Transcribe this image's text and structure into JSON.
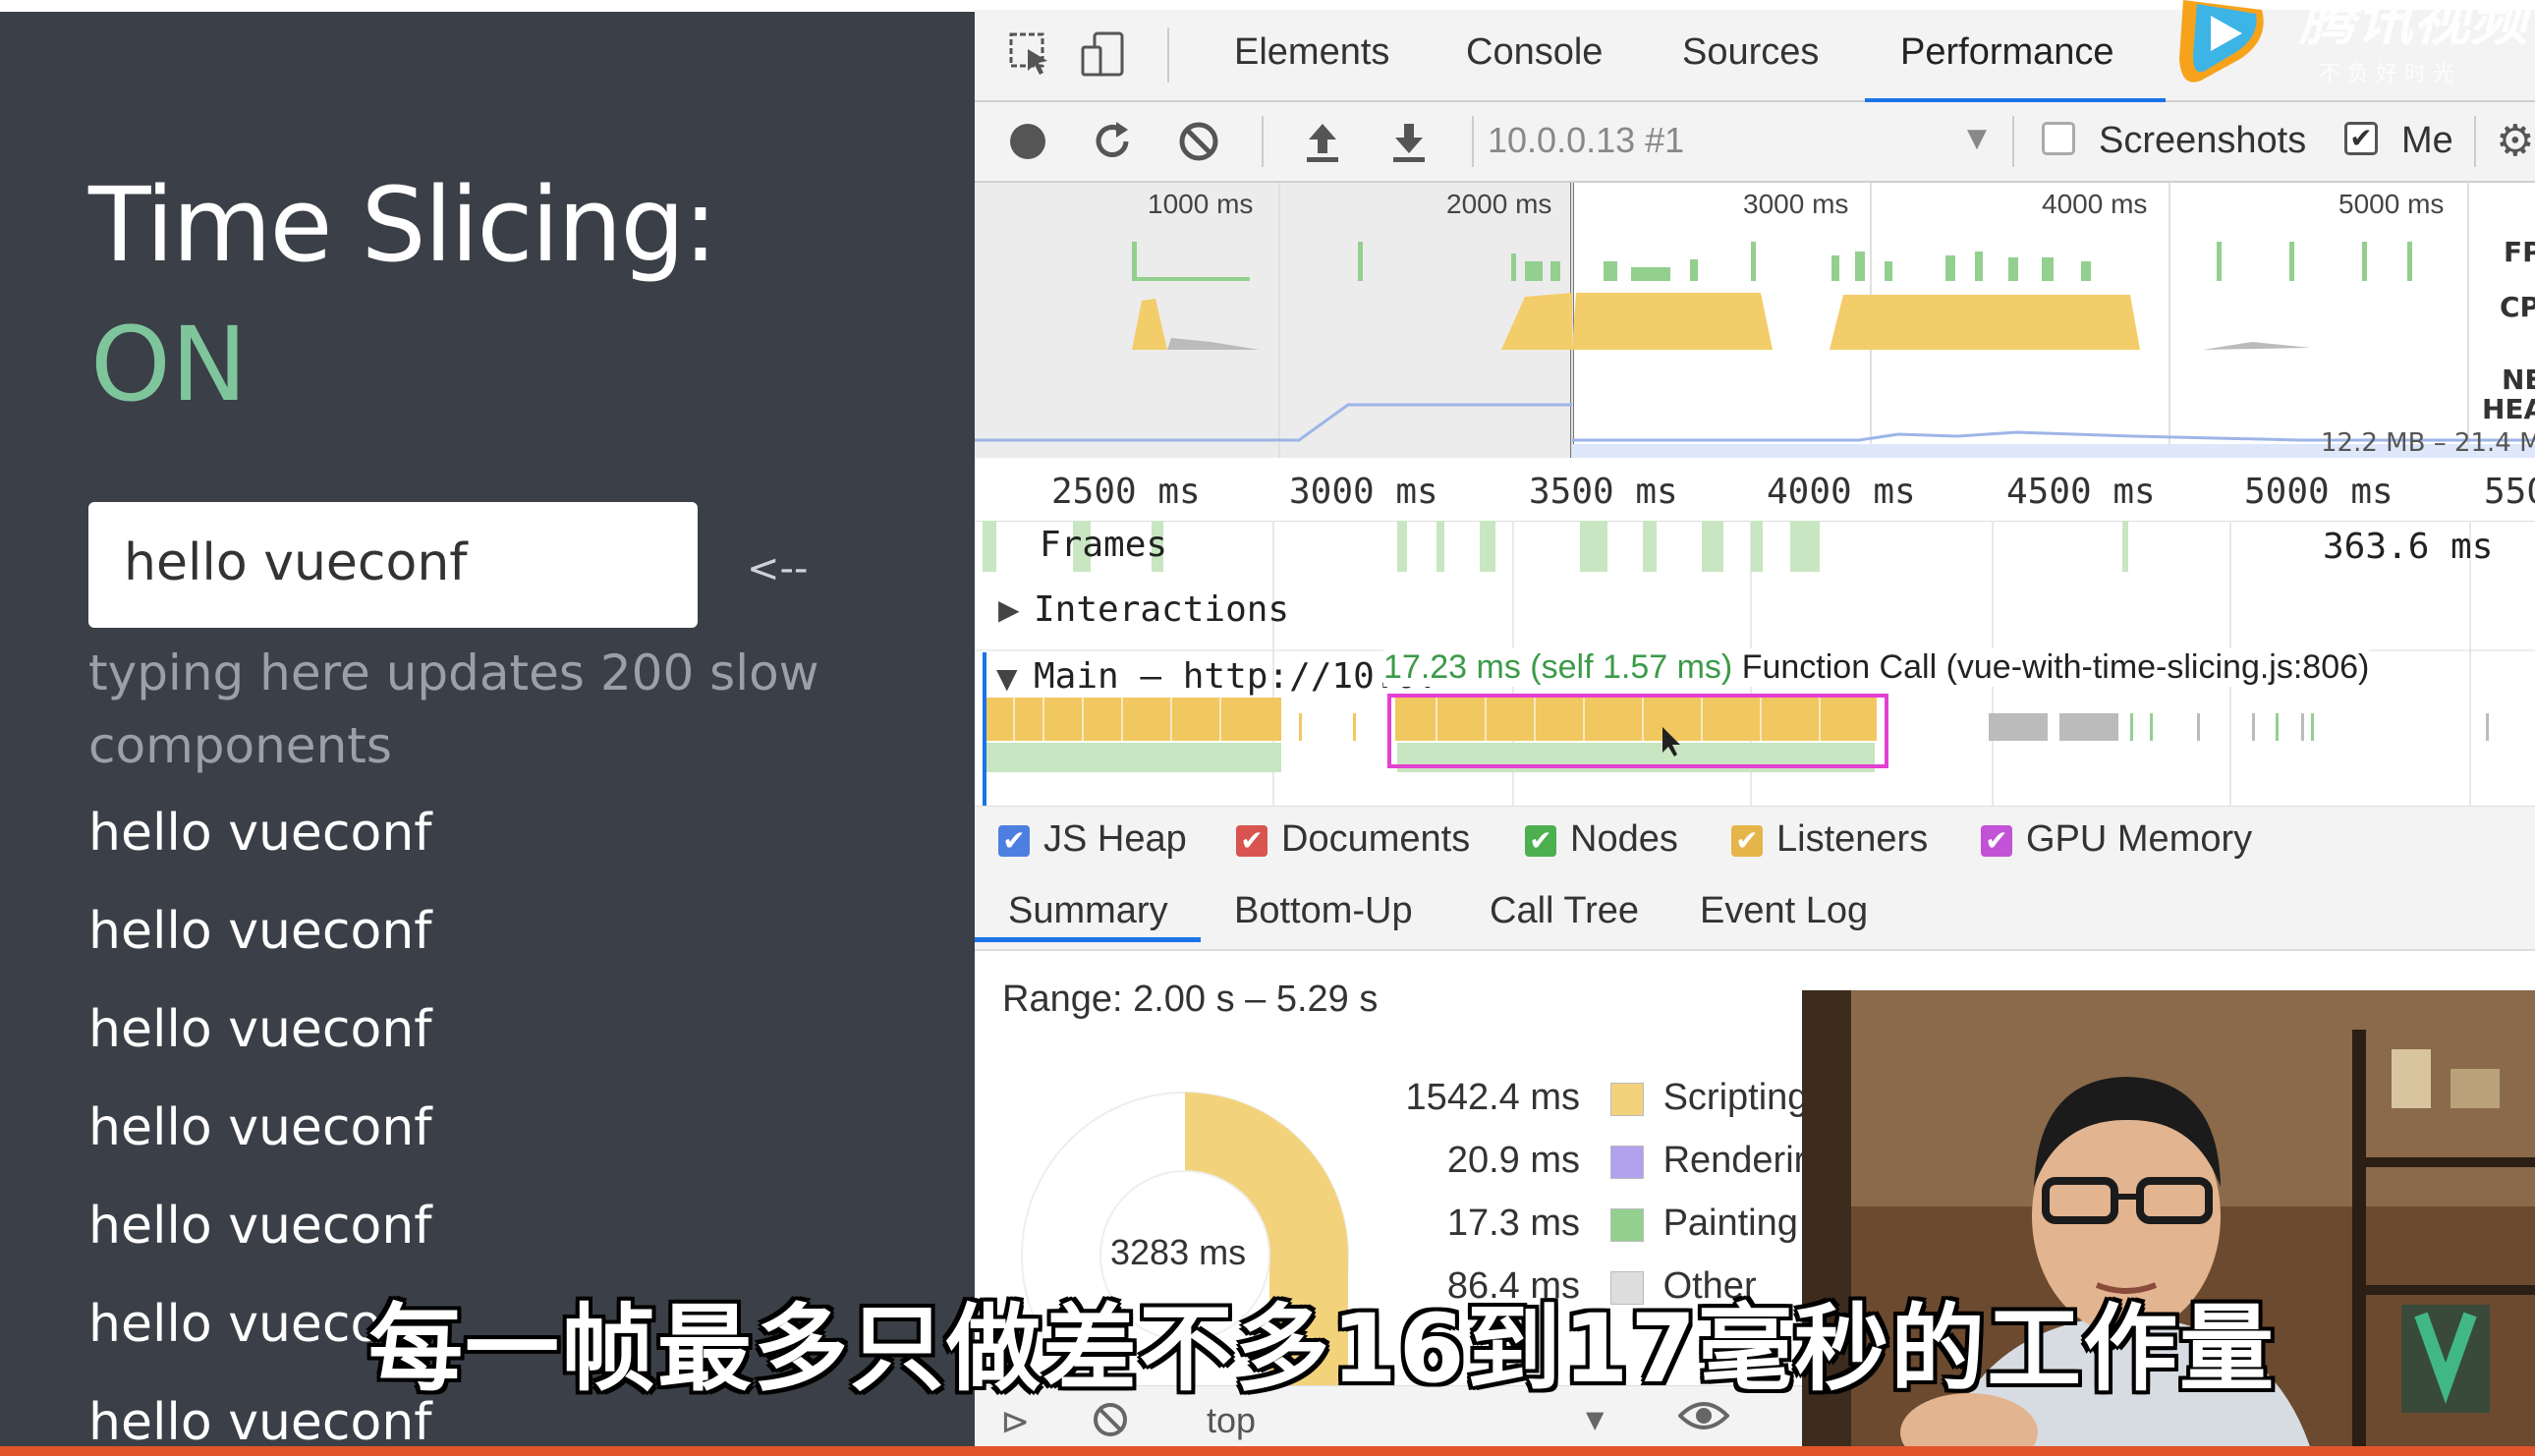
{
  "left_panel": {
    "title": "Time Slicing:",
    "status": "ON",
    "input_value": "hello vueconf",
    "arrow": "<--",
    "helper_text": "typing here updates 200 slow components",
    "items": [
      "hello vueconf",
      "hello vueconf",
      "hello vueconf",
      "hello vueconf",
      "hello vueconf",
      "hello vuecon",
      "hello vueconf"
    ]
  },
  "devtools": {
    "tabs": [
      "Elements",
      "Console",
      "Sources",
      "Performance"
    ],
    "active_tab": "Performance",
    "toolbar": {
      "recording_select": "10.0.0.13 #1",
      "screenshots_label": "Screenshots",
      "memory_label": "Me"
    },
    "overview_ticks": [
      "1000 ms",
      "2000 ms",
      "3000 ms",
      "4000 ms",
      "5000 ms"
    ],
    "overview_side_labels": [
      "FP",
      "CP",
      "NE",
      "HEA"
    ],
    "heap_range": "12.2 MB – 21.4 M",
    "ruler_ticks": [
      "2500 ms",
      "3000 ms",
      "3500 ms",
      "4000 ms",
      "4500 ms",
      "5000 ms",
      "550"
    ],
    "frames_label": "Frames",
    "frame_duration": "363.6 ms",
    "interactions_label": "Interactions",
    "main_label": "Main — http://10.0.",
    "tooltip": {
      "time": "17.23 ms (self 1.57 ms)",
      "text": "Function Call (vue-with-time-slicing.js:806)"
    },
    "legend": [
      {
        "label": "JS Heap",
        "color": "#4d7fe0"
      },
      {
        "label": "Documents",
        "color": "#d9534f"
      },
      {
        "label": "Nodes",
        "color": "#4caf50"
      },
      {
        "label": "Listeners",
        "color": "#e5b54a"
      },
      {
        "label": "GPU Memory",
        "color": "#c252d6"
      }
    ],
    "subtabs": [
      "Summary",
      "Bottom-Up",
      "Call Tree",
      "Event Log"
    ],
    "active_subtab": "Summary",
    "range": "Range: 2.00 s – 5.29 s",
    "donut_total": "3283 ms",
    "summary": [
      {
        "value": "1542.4 ms",
        "label": "Scripting",
        "color": "#f3d27c"
      },
      {
        "value": "20.9 ms",
        "label": "Renderir",
        "color": "#b2a1ec"
      },
      {
        "value": "17.3 ms",
        "label": "Painting",
        "color": "#93cf8f"
      },
      {
        "value": "86.4 ms",
        "label": "Other",
        "color": "#dddddd"
      }
    ],
    "bottom_bar": {
      "context": "top"
    }
  },
  "subtitle": "每一帧最多只做差不多16到17毫秒的工作量",
  "watermark": {
    "text": "腾讯视频",
    "sub": "不 负 好 时 光"
  }
}
